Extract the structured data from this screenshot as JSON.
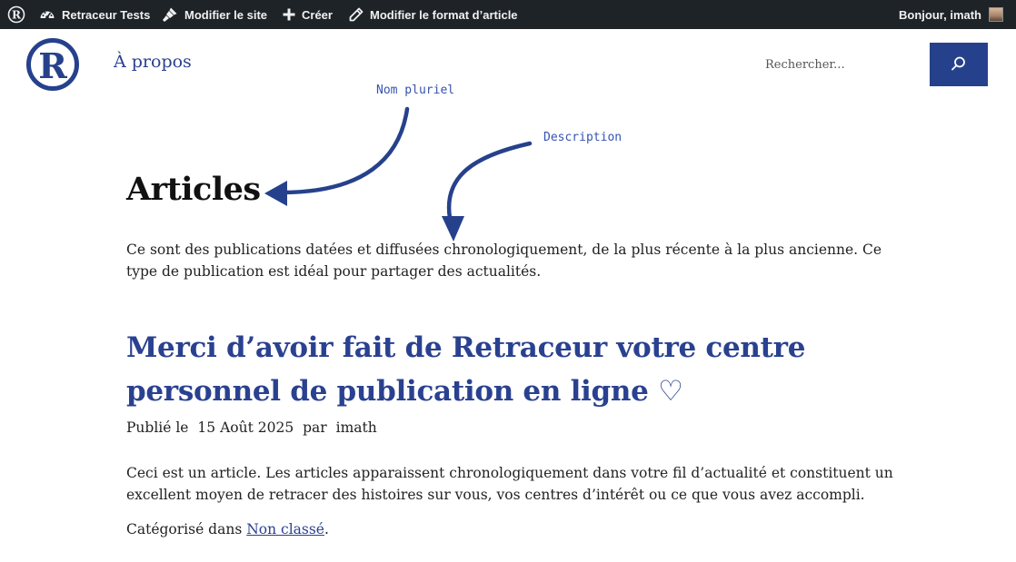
{
  "adminbar": {
    "site_name": "Retraceur Tests",
    "edit_site": "Modifier le site",
    "new": "Créer",
    "edit_format": "Modifier le format d’article",
    "greeting": "Bonjour, imath",
    "icons": [
      "retraceur-logo-icon",
      "dashboard-icon",
      "brush-icon",
      "plus-icon",
      "pencil-icon",
      "avatar"
    ]
  },
  "header": {
    "nav_about": "À propos",
    "search_placeholder": "Rechercher...",
    "search_button_icon": "search-icon",
    "brand_color": "#26418c"
  },
  "annotations": {
    "plural_name": "Nom pluriel",
    "description": "Description",
    "color": "#3553b0"
  },
  "archive": {
    "title": "Articles",
    "description": "Ce sont des publications datées et diffusées chronologiquement, de la plus récente à la plus ancienne. Ce type de publication est idéal pour partager des actualités."
  },
  "post": {
    "title": "Merci d’avoir fait de Retraceur votre centre personnel de publication en ligne ♡",
    "meta_published": "Publié le",
    "meta_date": "15 Août 2025",
    "meta_by": "par",
    "meta_author": "imath",
    "excerpt": "Ceci est un article. Les articles apparaissent chronologiquement dans votre fil d’actualité et constituent un excellent moyen de retracer des histoires sur vous, vos centres d’intérêt ou ce que vous avez accompli.",
    "categories_label": "Catégorisé dans",
    "category": "Non classé",
    "categories_end": "."
  }
}
